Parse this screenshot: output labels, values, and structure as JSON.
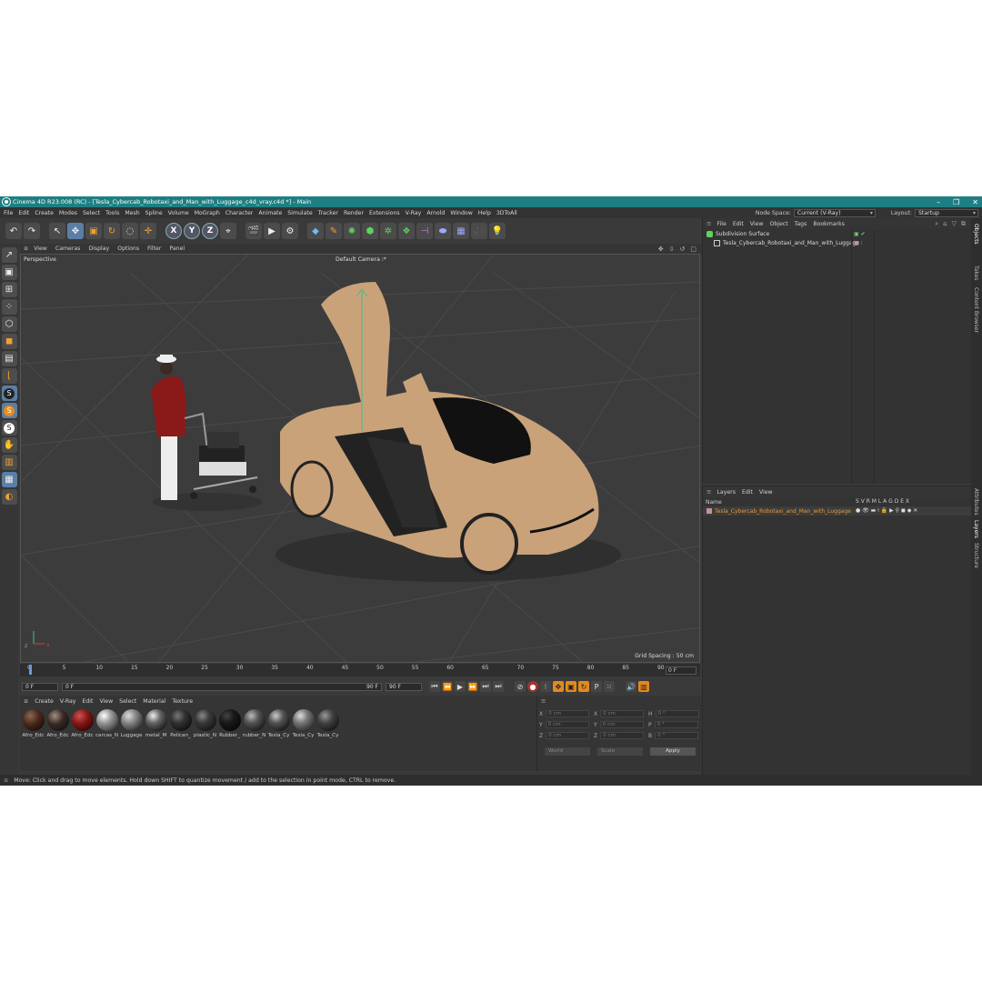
{
  "window": {
    "title": "Cinema 4D R23.008 (RC) - [Tesla_Cybercab_Robotaxi_and_Man_with_Luggage_c4d_vray.c4d *] - Main",
    "minimize": "–",
    "maximize": "❐",
    "close": "✕"
  },
  "menubar": [
    "File",
    "Edit",
    "Create",
    "Modes",
    "Select",
    "Tools",
    "Mesh",
    "Spline",
    "Volume",
    "MoGraph",
    "Character",
    "Animate",
    "Simulate",
    "Tracker",
    "Render",
    "Extensions",
    "V-Ray",
    "Arnold",
    "Window",
    "Help",
    "3DToAll"
  ],
  "node_space": {
    "label": "Node Space:",
    "value": "Current (V-Ray)"
  },
  "layout": {
    "label": "Layout:",
    "value": "Startup"
  },
  "viewport": {
    "menu": [
      "View",
      "Cameras",
      "Display",
      "Options",
      "Filter",
      "Panel"
    ],
    "name": "Perspective",
    "camera": "Default Camera ⁝*",
    "grid_spacing": "Grid Spacing : 50 cm"
  },
  "timeline": {
    "ticks": [
      "0",
      "5",
      "10",
      "15",
      "20",
      "25",
      "30",
      "35",
      "40",
      "45",
      "50",
      "55",
      "60",
      "65",
      "70",
      "75",
      "80",
      "85",
      "90"
    ],
    "current_frame": "0 F"
  },
  "playbar": {
    "start": "0 F",
    "current": "0 F",
    "end": "90 F",
    "end2": "90 F"
  },
  "material_panel": {
    "menu": [
      "Create",
      "V-Ray",
      "Edit",
      "View",
      "Select",
      "Material",
      "Texture"
    ],
    "materials": [
      "Afro_Edc",
      "Afro_Edc",
      "Afro_Edc",
      "carcas_N",
      "Luggage",
      "metal_M",
      "Pelican_",
      "plastic_N",
      "Rubber_",
      "rubber_N",
      "Tesla_Cy",
      "Tesla_Cy",
      "Tesla_Cy"
    ]
  },
  "coordinates": {
    "rows": [
      {
        "a": "X",
        "av": "0 cm",
        "b": "X",
        "bv": "0 cm",
        "c": "H",
        "cv": "0 °"
      },
      {
        "a": "Y",
        "av": "0 cm",
        "b": "Y",
        "bv": "0 cm",
        "c": "P",
        "cv": "0 °"
      },
      {
        "a": "Z",
        "av": "0 cm",
        "b": "Z",
        "bv": "0 cm",
        "c": "B",
        "cv": "0 °"
      }
    ],
    "world": "World",
    "scale": "Scale",
    "apply": "Apply"
  },
  "objects_panel": {
    "menu": [
      "File",
      "Edit",
      "View",
      "Object",
      "Tags",
      "Bookmarks"
    ],
    "items": [
      "Subdivision Surface",
      "Tesla_Cybercab_Robotaxi_and_Man_with_Luggage"
    ]
  },
  "layers_panel": {
    "menu": [
      "Layers",
      "Edit",
      "View"
    ],
    "name_header": "Name",
    "columns": "S V R M L A G D E X",
    "items": [
      "Tesla_Cybercab_Robotaxi_and_Man_with_Luggage"
    ]
  },
  "side_tabs": [
    "Objects",
    "Takes",
    "Content Browser",
    "Attributes",
    "Layers",
    "Structure"
  ],
  "status": "Move: Click and drag to move elements. Hold down SHIFT to quantize movement / add to the selection in point mode, CTRL to remove.",
  "colors": {
    "titlebar": "#1e7f83",
    "car_body": "#c9a27a",
    "axis_y": "#3fbf8f",
    "layer_text": "#e59a3a"
  }
}
